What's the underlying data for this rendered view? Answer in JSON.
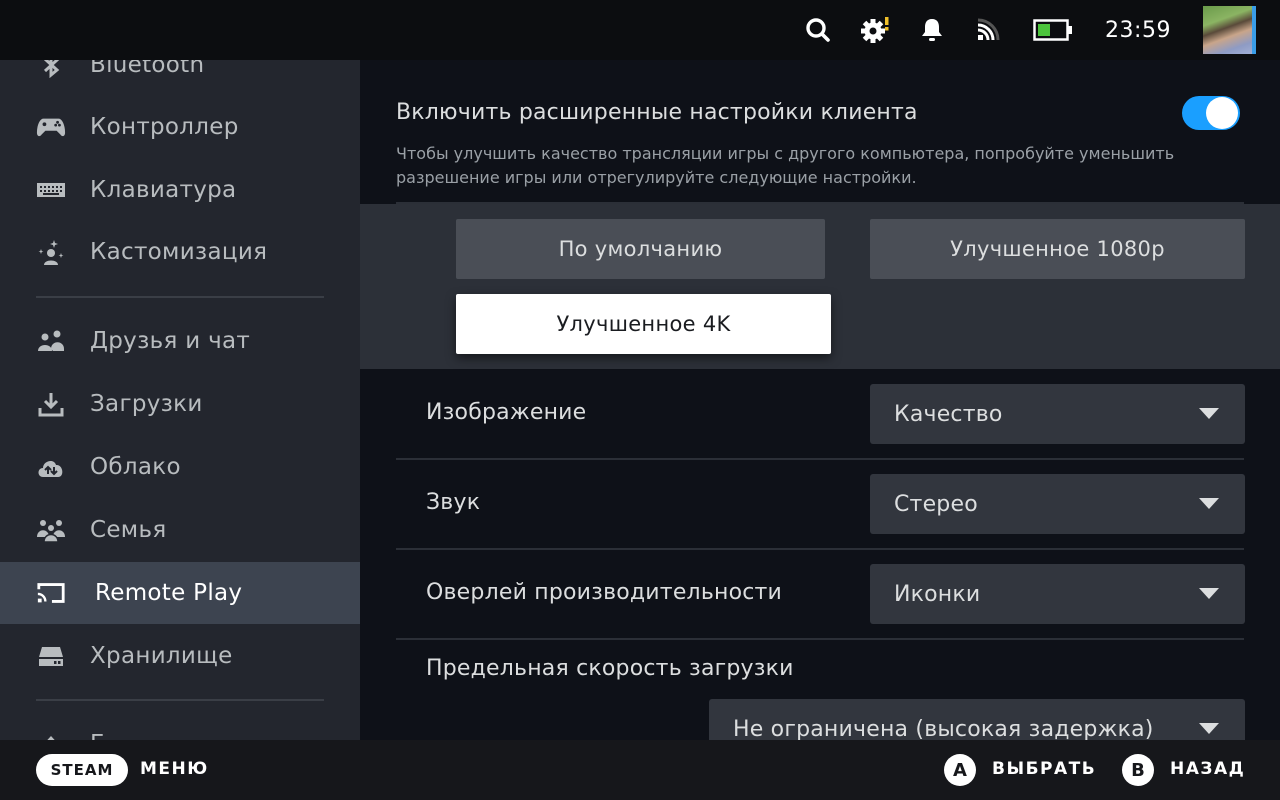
{
  "topbar": {
    "icons": [
      "search-icon",
      "settings-alert-icon",
      "bell-icon",
      "cast-signal-icon",
      "battery-icon"
    ],
    "battery_level": 0.45,
    "clock": "23:59",
    "alert_color": "#f0c02a",
    "battery_color": "#4cc43c"
  },
  "sidebar": {
    "items": [
      {
        "label": "Bluetooth",
        "icon": "bluetooth-icon"
      },
      {
        "label": "Контроллер",
        "icon": "controller-icon"
      },
      {
        "label": "Клавиатура",
        "icon": "keyboard-icon"
      },
      {
        "label": "Кастомизация",
        "icon": "customization-icon"
      },
      {
        "label": "Друзья и чат",
        "icon": "friends-icon"
      },
      {
        "label": "Загрузки",
        "icon": "download-icon"
      },
      {
        "label": "Облако",
        "icon": "cloud-icon"
      },
      {
        "label": "Семья",
        "icon": "family-icon"
      },
      {
        "label": "Remote Play",
        "icon": "remote-play-icon",
        "active": true
      },
      {
        "label": "Хранилище",
        "icon": "storage-icon"
      },
      {
        "label": "Г",
        "icon": "eject-icon"
      }
    ]
  },
  "main": {
    "advanced": {
      "title": "Включить расширенные настройки клиента",
      "description": "Чтобы улучшить качество трансляции игры с другого компьютера, попробуйте уменьшить разрешение игры или отрегулируйте следующие настройки.",
      "enabled": true,
      "accent": "#1a9fff"
    },
    "presets": [
      {
        "label": "По умолчанию",
        "selected": false
      },
      {
        "label": "Улучшенное 1080p",
        "selected": false
      },
      {
        "label": "Улучшенное 4K",
        "selected": true
      }
    ],
    "settings": [
      {
        "label": "Изображение",
        "value": "Качество"
      },
      {
        "label": "Звук",
        "value": "Стерео"
      },
      {
        "label": "Оверлей производительности",
        "value": "Иконки"
      },
      {
        "label": "Предельная скорость загрузки",
        "value": "Не ограничена (высокая задержка)"
      }
    ]
  },
  "bottombar": {
    "steam": "STEAM",
    "menu": "МЕНЮ",
    "a_button": "A",
    "select": "ВЫБРАТЬ",
    "b_button": "B",
    "back": "НАЗАД"
  }
}
